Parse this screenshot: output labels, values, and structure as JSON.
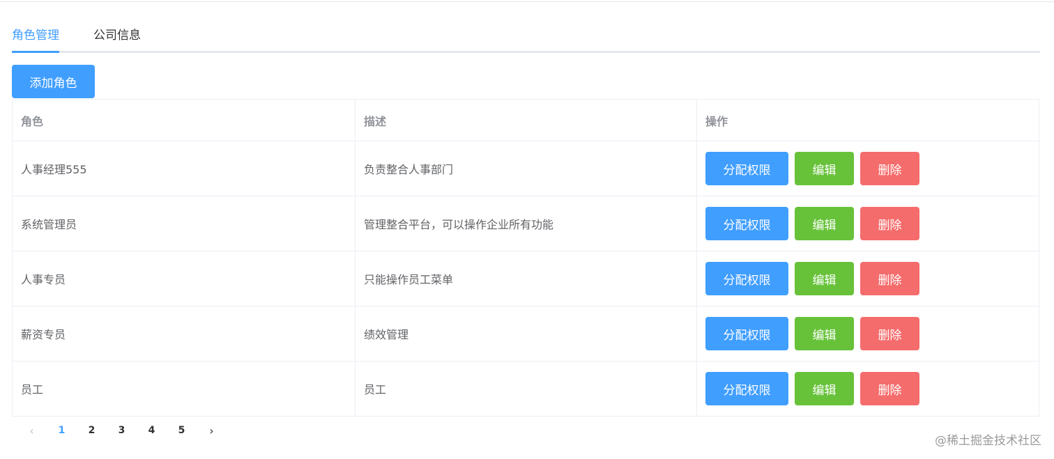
{
  "tabs": [
    {
      "label": "角色管理",
      "active": true
    },
    {
      "label": "公司信息",
      "active": false
    }
  ],
  "toolbar": {
    "add_label": "添加角色"
  },
  "table": {
    "headers": [
      "角色",
      "描述",
      "操作"
    ],
    "rows": [
      {
        "role": "人事经理555",
        "desc": "负责整合人事部门"
      },
      {
        "role": "系统管理员",
        "desc": "管理整合平台，可以操作企业所有功能"
      },
      {
        "role": "人事专员",
        "desc": "只能操作员工菜单"
      },
      {
        "role": "薪资专员",
        "desc": "绩效管理"
      },
      {
        "role": "员工",
        "desc": "员工"
      }
    ],
    "actions": {
      "assign": "分配权限",
      "edit": "编辑",
      "delete": "删除"
    }
  },
  "pagination": {
    "prev": "‹",
    "pages": [
      "1",
      "2",
      "3",
      "4",
      "5"
    ],
    "current": "1",
    "next": "›"
  },
  "watermark": "@稀土掘金技术社区",
  "colors": {
    "primary": "#409eff",
    "success": "#67c23a",
    "danger": "#f56c6c"
  }
}
